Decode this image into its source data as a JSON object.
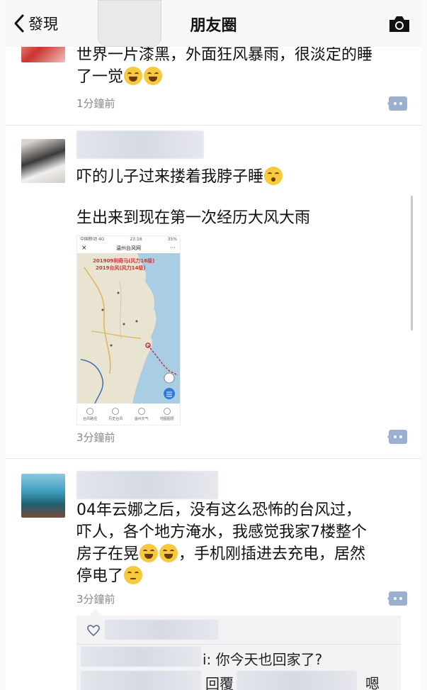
{
  "navbar": {
    "back_label": "發現",
    "title": "朋友圈"
  },
  "posts": [
    {
      "text_line1": "世界一片漆黑，外面狂风暴雨，很淡定的睡",
      "text_line2": "了一觉",
      "time": "1分鐘前"
    },
    {
      "text1": "吓的儿子过来搂着我脖子睡",
      "text2": "生出来到现在第一次经历大风大雨",
      "time": "3分鐘前",
      "map": {
        "status_left": "中国移动 4G",
        "status_mid": "23:16",
        "status_right": "35%",
        "title": "温州台风网",
        "red_line1": "201909利奇马(风力16级)",
        "red_line2": "2019台风(风力14级)",
        "tabs": [
          "台风路径",
          "历史台风",
          "温州天气",
          "地图图层"
        ]
      }
    },
    {
      "line1": "04年云娜之后，没有这么恐怖的台风过，",
      "line2": "吓人，各个地方淹水，我感觉我家7楼整个",
      "line3_a": "房子在晃",
      "line3_b": "，手机刚插进去充电，居然",
      "line4": "停电了",
      "time": "3分鐘前",
      "comments": {
        "line1_tail": "i: 你今天也回家了?",
        "line2_mid": "回覆",
        "line2_end": "嗯"
      }
    }
  ],
  "colors": {
    "more_button": "#9bb0cf",
    "time_gray": "#8a8a8a"
  }
}
